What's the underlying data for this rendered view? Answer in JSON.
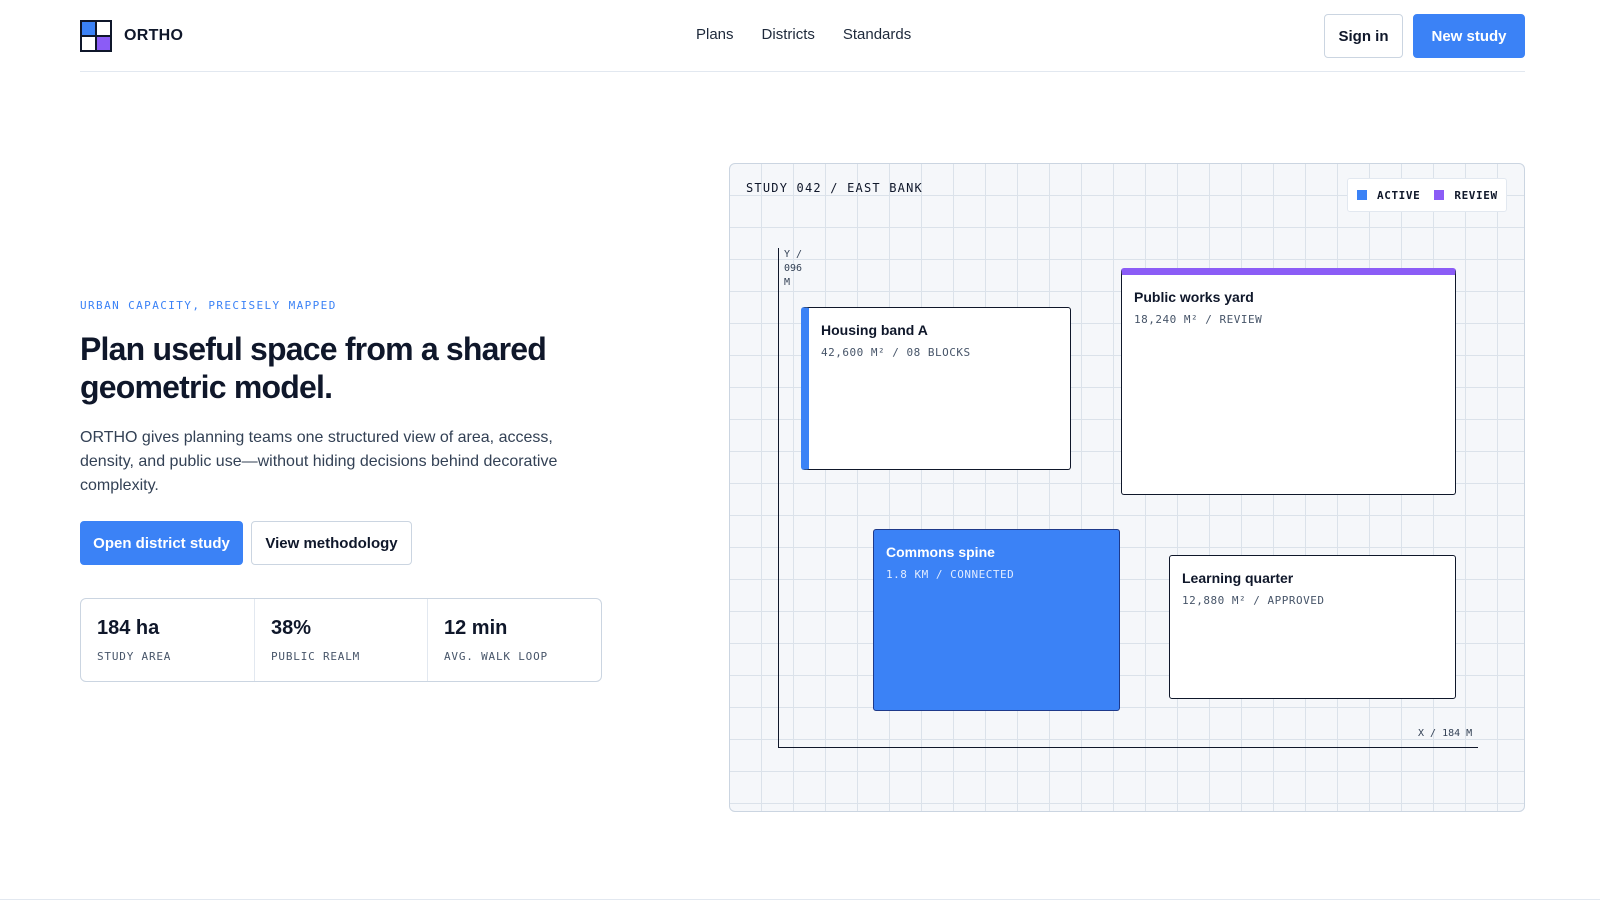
{
  "brand": {
    "name": "ORTHO"
  },
  "nav": {
    "items": [
      "Plans",
      "Districts",
      "Standards"
    ]
  },
  "header": {
    "sign_in_label": "Sign in",
    "new_study_label": "New study"
  },
  "hero": {
    "eyebrow": "URBAN CAPACITY, PRECISELY MAPPED",
    "title": "Plan useful space from a shared geometric model.",
    "lead": "ORTHO gives planning teams one structured view of area, access, density, and public use—without hiding decisions behind decorative complexity.",
    "primary_cta": "Open district study",
    "secondary_cta": "View methodology"
  },
  "stats": [
    {
      "value": "184 ha",
      "label": "STUDY AREA"
    },
    {
      "value": "38%",
      "label": "PUBLIC REALM"
    },
    {
      "value": "12 min",
      "label": "AVG. WALK LOOP"
    }
  ],
  "study": {
    "title": "STUDY 042 / EAST BANK",
    "legend": {
      "active": "ACTIVE",
      "review": "REVIEW"
    },
    "axis_y_label": "Y / 096 M",
    "axis_x_label": "X / 184 M",
    "blocks": [
      {
        "name": "Housing band A",
        "meta": "42,600 M² / 08 BLOCKS"
      },
      {
        "name": "Public works yard",
        "meta": "18,240 M² / REVIEW"
      },
      {
        "name": "Commons spine",
        "meta": "1.8 KM / CONNECTED"
      },
      {
        "name": "Learning quarter",
        "meta": "12,880 M² / APPROVED"
      }
    ]
  },
  "colors": {
    "accent": "#3b82f6",
    "review": "#8b5cf6",
    "ink": "#0f172a",
    "border": "#cbd5e1"
  }
}
